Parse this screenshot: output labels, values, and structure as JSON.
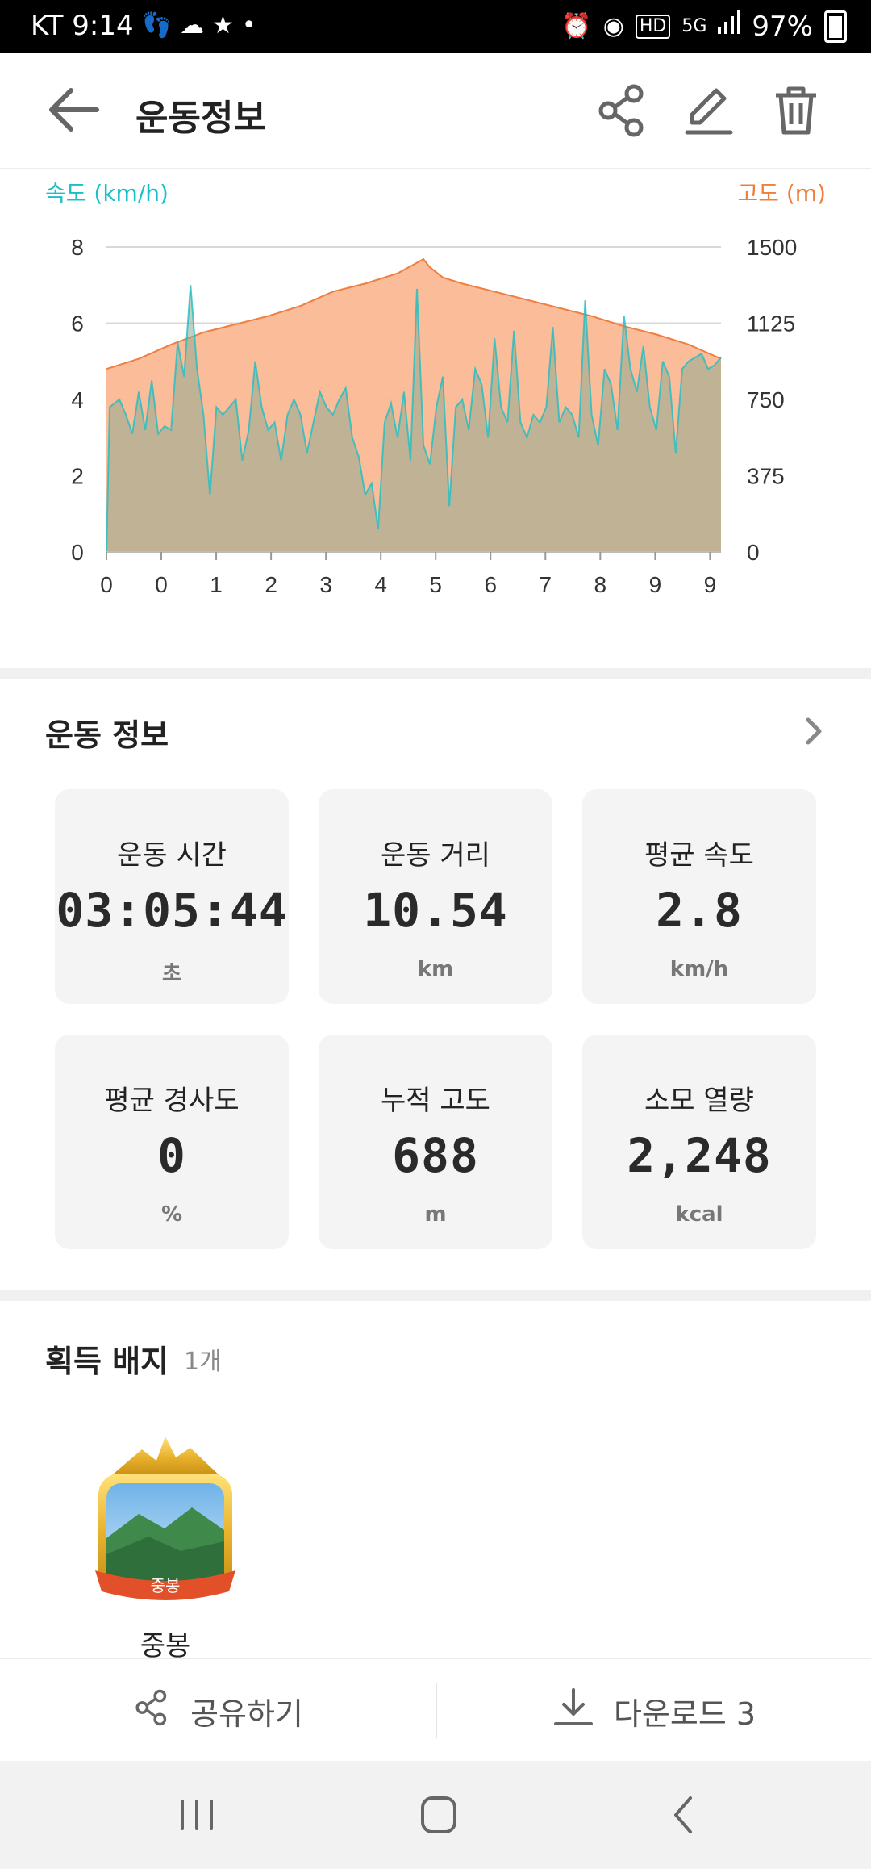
{
  "status_bar": {
    "carrier_time": "KT 9:14",
    "battery": "97%",
    "icons": [
      "footprint-icon",
      "cloud-icon",
      "running-shoe-icon",
      "dot-icon",
      "alarm-icon",
      "location-icon",
      "hd-icon",
      "5g-icon",
      "signal-icon",
      "battery-icon"
    ]
  },
  "app_bar": {
    "title": "운동정보",
    "icons": [
      "back-arrow-icon",
      "share-icon",
      "edit-icon",
      "delete-icon"
    ]
  },
  "chart_data": {
    "type": "area",
    "left_axis_title": "속도 (km/h)",
    "right_axis_title": "고도 (m)",
    "colors": {
      "speed": "#1bbfc6",
      "altitude": "#f07e3e",
      "altitude_fill": "#fbb894",
      "overlap_fill": "#c5c0a0"
    },
    "x_tick_labels": [
      "0",
      "0",
      "1",
      "2",
      "3",
      "4",
      "5",
      "6",
      "7",
      "8",
      "9",
      "9"
    ],
    "y_left": {
      "ticks": [
        0,
        2,
        4,
        6,
        8
      ],
      "range": [
        0,
        8
      ]
    },
    "y_right": {
      "ticks": [
        0,
        375,
        750,
        1125,
        1500
      ],
      "range": [
        0,
        1500
      ]
    },
    "grid": true,
    "x_range": [
      0,
      9.5
    ],
    "series": [
      {
        "name": "속도 (km/h)",
        "axis": "left",
        "x": [
          0,
          0.05,
          0.2,
          0.3,
          0.4,
          0.5,
          0.6,
          0.7,
          0.8,
          0.9,
          1.0,
          1.1,
          1.2,
          1.3,
          1.4,
          1.5,
          1.6,
          1.7,
          1.8,
          1.9,
          2.0,
          2.1,
          2.2,
          2.3,
          2.4,
          2.5,
          2.6,
          2.7,
          2.8,
          2.9,
          3.0,
          3.1,
          3.2,
          3.3,
          3.4,
          3.5,
          3.6,
          3.7,
          3.8,
          3.9,
          4.0,
          4.1,
          4.2,
          4.3,
          4.4,
          4.5,
          4.6,
          4.7,
          4.8,
          4.9,
          5.0,
          5.1,
          5.2,
          5.3,
          5.4,
          5.5,
          5.6,
          5.7,
          5.8,
          5.9,
          6.0,
          6.1,
          6.2,
          6.3,
          6.4,
          6.5,
          6.6,
          6.7,
          6.8,
          6.9,
          7.0,
          7.1,
          7.2,
          7.3,
          7.4,
          7.5,
          7.6,
          7.7,
          7.8,
          7.9,
          8.0,
          8.1,
          8.2,
          8.3,
          8.4,
          8.5,
          8.6,
          8.7,
          8.8,
          8.9,
          9.0,
          9.1,
          9.2,
          9.3,
          9.4,
          9.5
        ],
        "values": [
          0,
          3.8,
          4.0,
          3.6,
          3.1,
          4.2,
          3.2,
          4.5,
          3.1,
          3.3,
          3.2,
          5.5,
          4.6,
          7.0,
          4.8,
          3.6,
          1.5,
          3.8,
          3.6,
          3.8,
          4.0,
          2.4,
          3.2,
          5.0,
          3.8,
          3.2,
          3.4,
          2.4,
          3.6,
          4.0,
          3.6,
          2.6,
          3.4,
          4.2,
          3.8,
          3.6,
          4.0,
          4.3,
          3.0,
          2.5,
          1.5,
          1.8,
          0.6,
          3.4,
          3.9,
          3.0,
          4.2,
          2.4,
          6.9,
          2.8,
          2.3,
          3.8,
          4.6,
          1.2,
          3.8,
          4.0,
          3.2,
          4.8,
          4.4,
          3.0,
          5.6,
          3.8,
          3.4,
          5.8,
          3.4,
          3.0,
          3.6,
          3.4,
          3.8,
          5.9,
          3.4,
          3.8,
          3.6,
          3.0,
          6.6,
          3.6,
          2.8,
          4.8,
          4.4,
          3.2,
          6.2,
          4.8,
          4.2,
          5.4,
          3.8,
          3.2,
          5.0,
          4.6,
          2.6,
          4.8,
          5.0,
          5.1,
          5.2,
          4.8,
          4.9,
          5.1
        ]
      },
      {
        "name": "고도 (m)",
        "axis": "right",
        "x": [
          0,
          0.5,
          1.0,
          1.5,
          2.0,
          2.5,
          3.0,
          3.5,
          4.0,
          4.5,
          4.9,
          5.0,
          5.2,
          5.5,
          6.0,
          6.5,
          7.0,
          7.5,
          8.0,
          8.5,
          9.0,
          9.5
        ],
        "values": [
          900,
          950,
          1020,
          1080,
          1120,
          1160,
          1210,
          1280,
          1320,
          1370,
          1440,
          1400,
          1350,
          1320,
          1280,
          1240,
          1200,
          1160,
          1110,
          1070,
          1020,
          950
        ]
      }
    ]
  },
  "workout_info": {
    "title": "운동 정보",
    "chevron_icon": "chevron-right-icon",
    "cards": [
      {
        "label": "운동 시간",
        "value": "03:05:44",
        "unit": "초"
      },
      {
        "label": "운동 거리",
        "value": "10.54",
        "unit": "km"
      },
      {
        "label": "평균 속도",
        "value": "2.8",
        "unit": "km/h"
      },
      {
        "label": "평균 경사도",
        "value": "0",
        "unit": "%"
      },
      {
        "label": "누적 고도",
        "value": "688",
        "unit": "m"
      },
      {
        "label": "소모 열량",
        "value": "2,248",
        "unit": "kcal"
      }
    ]
  },
  "badges": {
    "title": "획득 배지",
    "count": "1개",
    "items": [
      {
        "name": "중봉",
        "banner_text": "중봉",
        "icon": "mountain-badge-icon"
      }
    ]
  },
  "action_bar": {
    "share_label": "공유하기",
    "download_label": "다운로드 3",
    "share_icon": "share-icon",
    "download_icon": "download-icon"
  },
  "nav_bar": {
    "icons": [
      "recent-apps-icon",
      "home-icon",
      "back-icon"
    ]
  }
}
